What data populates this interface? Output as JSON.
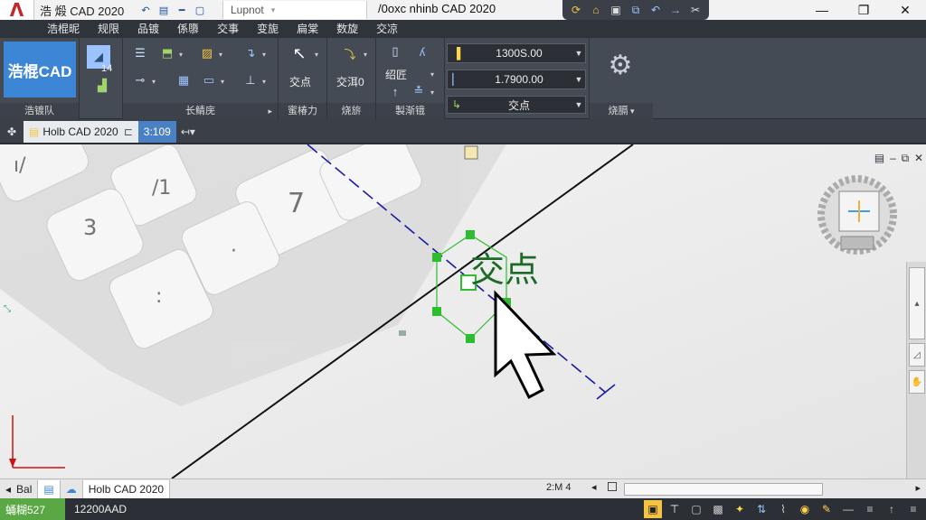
{
  "titlebar": {
    "left_title": "浩 煅 CAD 2020",
    "search_text": "Lupnot",
    "window_title": "/0oxc nhinb CAD 2020",
    "min": "—",
    "max": "❐",
    "close": "✕"
  },
  "menu": [
    "浩棍昵",
    "规限",
    "品镀",
    "係隳",
    "交事",
    "变旎",
    "扁棠",
    "数旋",
    "交凉"
  ],
  "ribbon": {
    "brand_button": "浩棍CAD",
    "panel_brand_label": "浩镀队",
    "panel_draw_label": "长鲭庑",
    "panel_modify_label": "蜜椿力",
    "panel_layer_label": "烧旂",
    "panel_props_label": "製渐锇",
    "panel_view_label": "烧膈",
    "btn_jiaodian": "交点",
    "btn_jiaocha": "交洱0",
    "props_row1": "绍匠",
    "props_combo1": "1300S.00",
    "props_combo2": "1.7900.00",
    "props_combo3": "交点",
    "small_14": "14"
  },
  "doctabs": {
    "active": "Holb CAD 2020",
    "new_tab": "3:109"
  },
  "canvas": {
    "snap_label": "交点"
  },
  "layoutbar": {
    "model_tab": "Bal",
    "layout_tab": "Holb CAD 2020",
    "zoom_text": "2:M 4"
  },
  "statusbar": {
    "green": "蛹糊527",
    "coord": "12200AAD"
  },
  "colors": {
    "accent": "#3d86d6",
    "grip": "#2ebd2e",
    "snap_text": "#1b6a25",
    "axis_line": "#1a1aa8",
    "status_green": "#5aa845"
  }
}
